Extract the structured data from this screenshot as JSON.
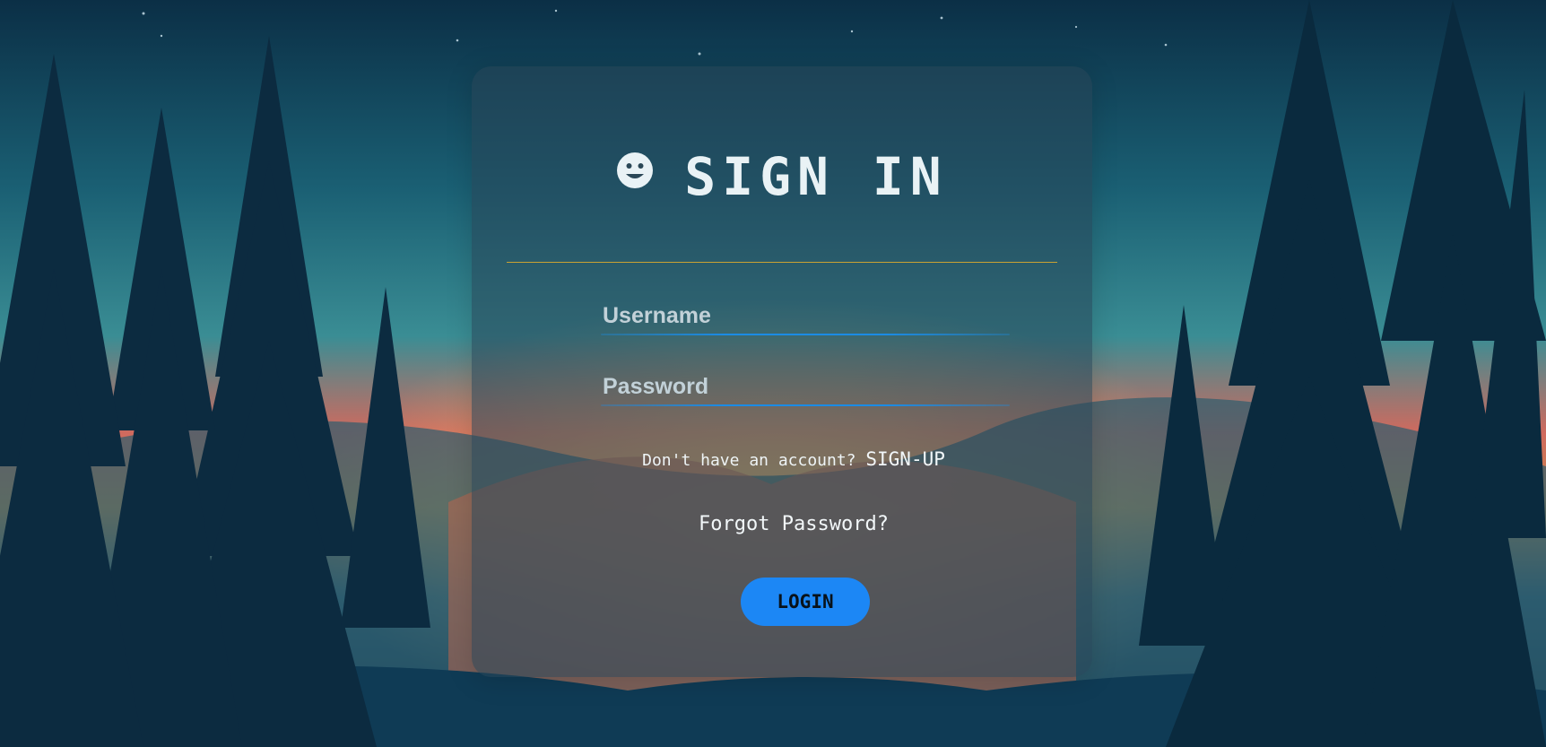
{
  "colors": {
    "accent_button": "#1c87f5",
    "divider": "#c9a233",
    "input_underline": "#1b8be5",
    "card_bg": "rgba(40,70,88,0.55)"
  },
  "header": {
    "icon": "smiley-icon",
    "title": "SIGN IN"
  },
  "form": {
    "username": {
      "placeholder": "Username",
      "value": ""
    },
    "password": {
      "placeholder": "Password",
      "value": ""
    }
  },
  "links": {
    "signup_prompt": "Don't have an account?",
    "signup_label": "SIGN-UP",
    "forgot_label": "Forgot Password?"
  },
  "actions": {
    "login_label": "LOGIN"
  }
}
